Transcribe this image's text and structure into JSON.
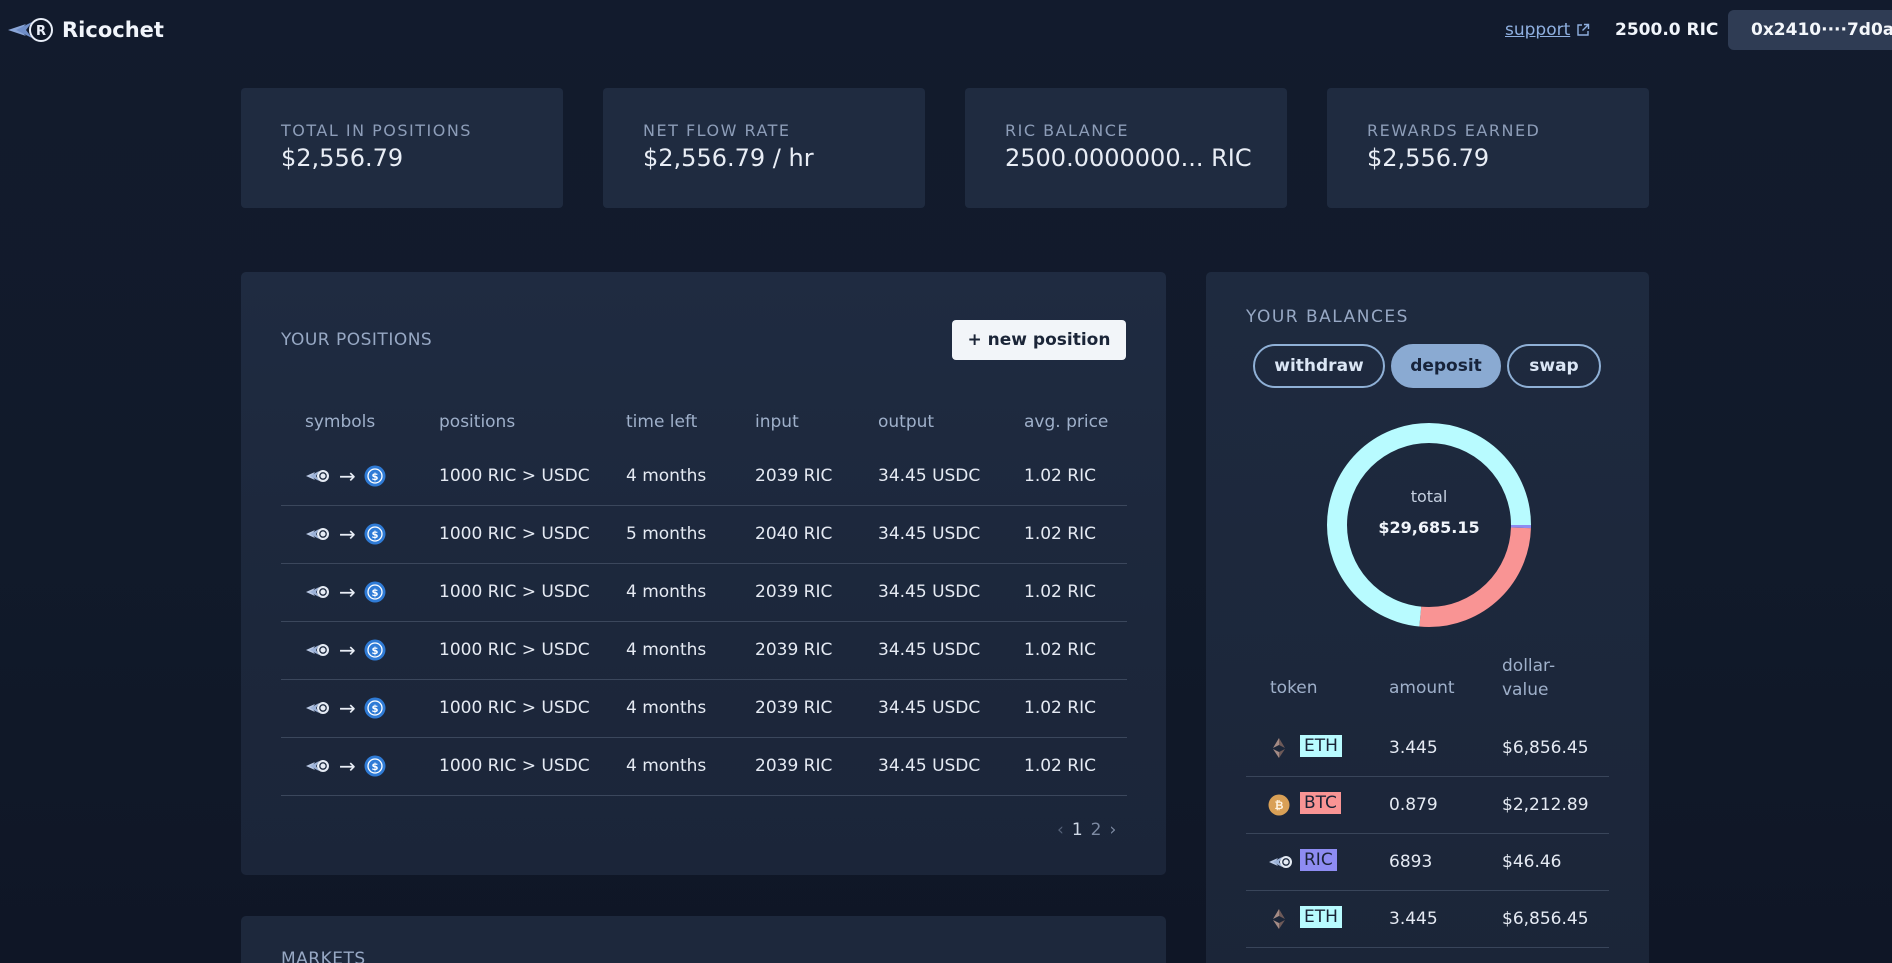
{
  "header": {
    "app_name": "Ricochet",
    "support_label": "support",
    "ric_balance": "2500.0 RIC",
    "wallet_address": "0x2410····7d0a"
  },
  "stats": [
    {
      "label": "TOTAL IN POSITIONS",
      "value": "$2,556.79"
    },
    {
      "label": "NET FLOW RATE",
      "value": "$2,556.79 / hr"
    },
    {
      "label": "RIC BALANCE",
      "value": "2500.0000000...  RIC"
    },
    {
      "label": "REWARDS EARNED",
      "value": "$2,556.79"
    }
  ],
  "positions": {
    "title": "YOUR POSITIONS",
    "new_position_label": "+ new position",
    "columns": [
      "symbols",
      "positions",
      "time left",
      "input",
      "output",
      "avg. price"
    ],
    "rows": [
      {
        "position": "1000 RIC > USDC",
        "time_left": "4 months",
        "input": "2039 RIC",
        "output": "34.45 USDC",
        "avg_price": "1.02 RIC"
      },
      {
        "position": "1000 RIC > USDC",
        "time_left": "5 months",
        "input": "2040 RIC",
        "output": "34.45 USDC",
        "avg_price": "1.02 RIC"
      },
      {
        "position": "1000 RIC > USDC",
        "time_left": "4 months",
        "input": "2039 RIC",
        "output": "34.45 USDC",
        "avg_price": "1.02 RIC"
      },
      {
        "position": "1000 RIC > USDC",
        "time_left": "4 months",
        "input": "2039 RIC",
        "output": "34.45 USDC",
        "avg_price": "1.02 RIC"
      },
      {
        "position": "1000 RIC > USDC",
        "time_left": "4 months",
        "input": "2039 RIC",
        "output": "34.45 USDC",
        "avg_price": "1.02 RIC"
      },
      {
        "position": "1000 RIC > USDC",
        "time_left": "4 months",
        "input": "2039 RIC",
        "output": "34.45 USDC",
        "avg_price": "1.02 RIC"
      }
    ],
    "pager": {
      "current": "1",
      "next": "2"
    }
  },
  "markets": {
    "title": "MARKETS"
  },
  "balances": {
    "title": "YOUR BALANCES",
    "buttons": {
      "withdraw": "withdraw",
      "deposit": "deposit",
      "swap": "swap"
    },
    "total_label": "total",
    "total_value": "$29,685.15",
    "donut_segments": [
      {
        "token": "ETH",
        "fraction": 0.735,
        "color": "#b8fbff"
      },
      {
        "token": "BTC",
        "fraction": 0.26,
        "color": "#f99494"
      },
      {
        "token": "RIC",
        "fraction": 0.005,
        "color": "#8e8cf2"
      }
    ],
    "columns": [
      "token",
      "amount",
      "dollar-\nvalue"
    ],
    "column_dollar_1": "dollar-",
    "column_dollar_2": "value",
    "rows": [
      {
        "token": "ETH",
        "amount": "3.445",
        "value": "$6,856.45",
        "badge_color": "#b8fbff",
        "icon": "eth-icon"
      },
      {
        "token": "BTC",
        "amount": "0.879",
        "value": "$2,212.89",
        "badge_color": "#f99494",
        "icon": "btc-icon"
      },
      {
        "token": "RIC",
        "amount": "6893",
        "value": "$46.46",
        "badge_color": "#8e8cf2",
        "icon": "ric-icon"
      },
      {
        "token": "ETH",
        "amount": "3.445",
        "value": "$6,856.45",
        "badge_color": "#b8fbff",
        "icon": "eth-icon"
      }
    ]
  }
}
